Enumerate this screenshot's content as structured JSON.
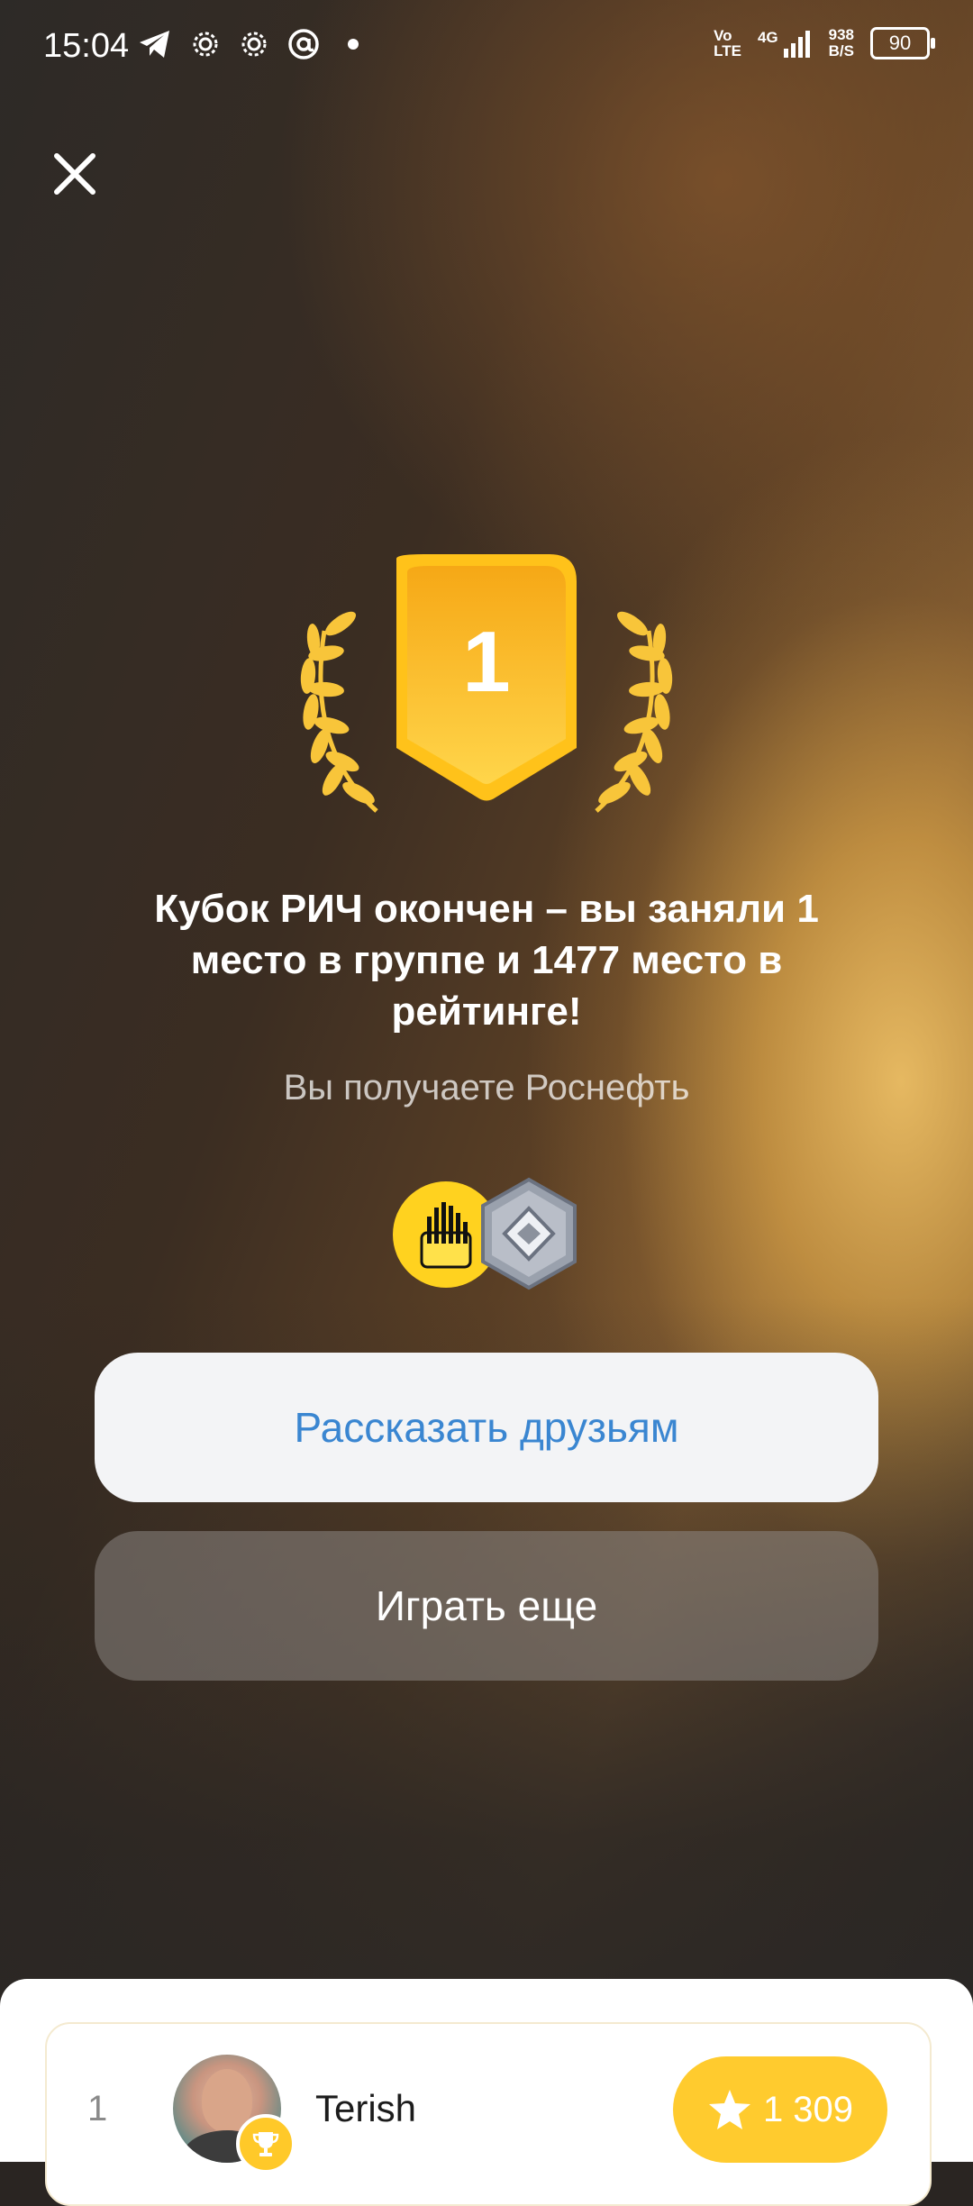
{
  "status_bar": {
    "time": "15:04",
    "network_line1": "Vo",
    "network_line2": "LTE",
    "network_type": "4G",
    "speed_value": "938",
    "speed_unit": "B/S",
    "battery": "90"
  },
  "award": {
    "place": "1"
  },
  "result": {
    "title": "Кубок РИЧ окончен – вы заняли 1 место в группе и 1477 место в рейтинге!",
    "subtitle": "Вы получаете Роснефть"
  },
  "actions": {
    "share_label": "Рассказать друзьям",
    "play_again_label": "Играть еще"
  },
  "leaderboard": {
    "rows": [
      {
        "rank": "1",
        "name": "Terish",
        "score": "1 309"
      }
    ]
  },
  "colors": {
    "gold": "#ffc929",
    "button_text_blue": "#3a86d1",
    "rosneft_yellow": "#ffd21f"
  },
  "icons": {
    "close": "close-icon",
    "star": "star-icon",
    "trophy": "trophy-icon",
    "laurel": "laurel-icon",
    "league": "diamond-league-icon",
    "rosneft": "rosneft-logo-icon"
  }
}
